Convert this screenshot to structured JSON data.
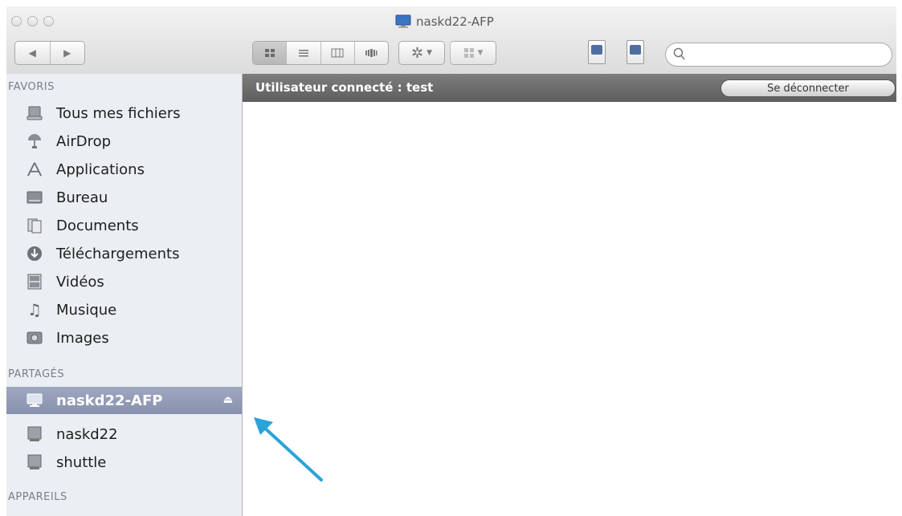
{
  "window": {
    "title": "naskd22-AFP",
    "title_icon": "network-display-icon"
  },
  "toolbar": {
    "back_icon": "back-arrow-icon",
    "forward_icon": "forward-arrow-icon",
    "view_modes": [
      "icon-view-icon",
      "list-view-icon",
      "column-view-icon",
      "coverflow-view-icon"
    ],
    "action_icon": "gear-icon",
    "arrange_icon": "arrange-grid-icon",
    "search": {
      "placeholder": "",
      "value": ""
    }
  },
  "sidebar": {
    "favorites_header": "FAVORIS",
    "favorites": [
      {
        "label": "Tous mes fichiers",
        "icon": "all-files-icon"
      },
      {
        "label": "AirDrop",
        "icon": "airdrop-icon"
      },
      {
        "label": "Applications",
        "icon": "applications-icon"
      },
      {
        "label": "Bureau",
        "icon": "desktop-icon"
      },
      {
        "label": "Documents",
        "icon": "documents-icon"
      },
      {
        "label": "Téléchargements",
        "icon": "downloads-icon"
      },
      {
        "label": "Vidéos",
        "icon": "movies-icon"
      },
      {
        "label": "Musique",
        "icon": "music-icon"
      },
      {
        "label": "Images",
        "icon": "pictures-icon"
      }
    ],
    "shared_header": "PARTAGÉS",
    "shared": [
      {
        "label": "naskd22-AFP",
        "icon": "network-display-icon",
        "selected": true
      },
      {
        "label": "naskd22",
        "icon": "server-icon"
      },
      {
        "label": "shuttle",
        "icon": "server-icon"
      }
    ],
    "devices_header": "APPAREILS"
  },
  "content": {
    "status_text": "Utilisateur connecté : test",
    "logout_label": "Se déconnecter"
  },
  "colors": {
    "selection": "#8f98b3",
    "statusbar": "#6b6b6b",
    "annotation_arrow": "#2aa3db"
  }
}
